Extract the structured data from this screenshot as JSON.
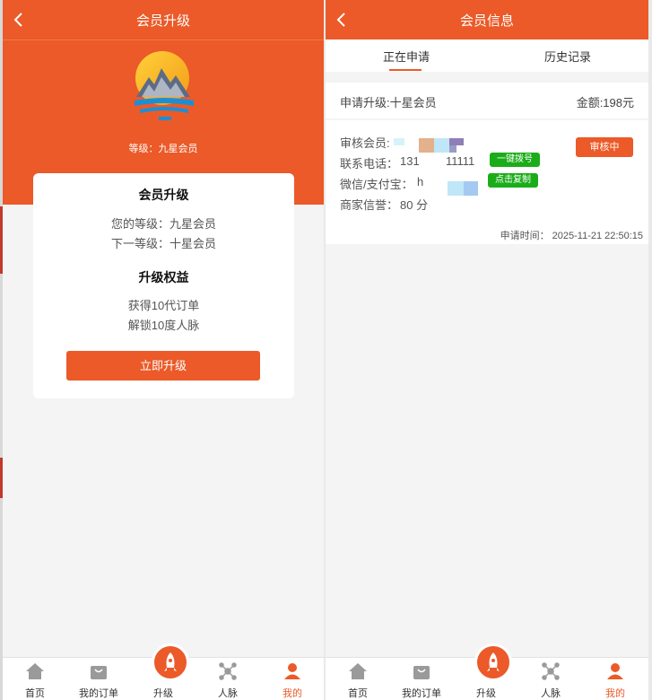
{
  "colors": {
    "accent": "#eb5a28",
    "green": "#1aad19"
  },
  "left": {
    "title": "会员升级",
    "hero": {
      "level_text": "等级：九星会员"
    },
    "card": {
      "heading": "会员升级",
      "current_level": "您的等级：九星会员",
      "next_level": "下一等级：十星会员",
      "benefits_heading": "升级权益",
      "benefits": [
        "获得10代订单",
        "解锁10度人脉"
      ],
      "button": "立即升级"
    }
  },
  "right": {
    "title": "会员信息",
    "tabs": [
      "正在申请",
      "历史记录"
    ],
    "summary": {
      "apply_level": "申请升级:十星会员",
      "amount": "金额:198元"
    },
    "detail": {
      "reviewer": "审核会员:",
      "phone_label": "联系电话：",
      "phone_start": "131",
      "phone_end": "11111",
      "dial_button": "一键拨号",
      "wechat_label": "微信/支付宝：",
      "wechat_value": "h",
      "copy_button": "点击复制",
      "credit": "商家信誉：",
      "credit_value": "80 分",
      "status": "审核中",
      "apply_time": "申请时间：  2025-11-21 22:50:15"
    }
  },
  "nav": [
    {
      "label": "首页",
      "icon": "home-icon"
    },
    {
      "label": "我的订单",
      "icon": "shopping-bag-icon"
    },
    {
      "label": "升级",
      "icon": "rocket-icon"
    },
    {
      "label": "人脉",
      "icon": "network-icon"
    },
    {
      "label": "我的",
      "icon": "user-icon"
    }
  ]
}
